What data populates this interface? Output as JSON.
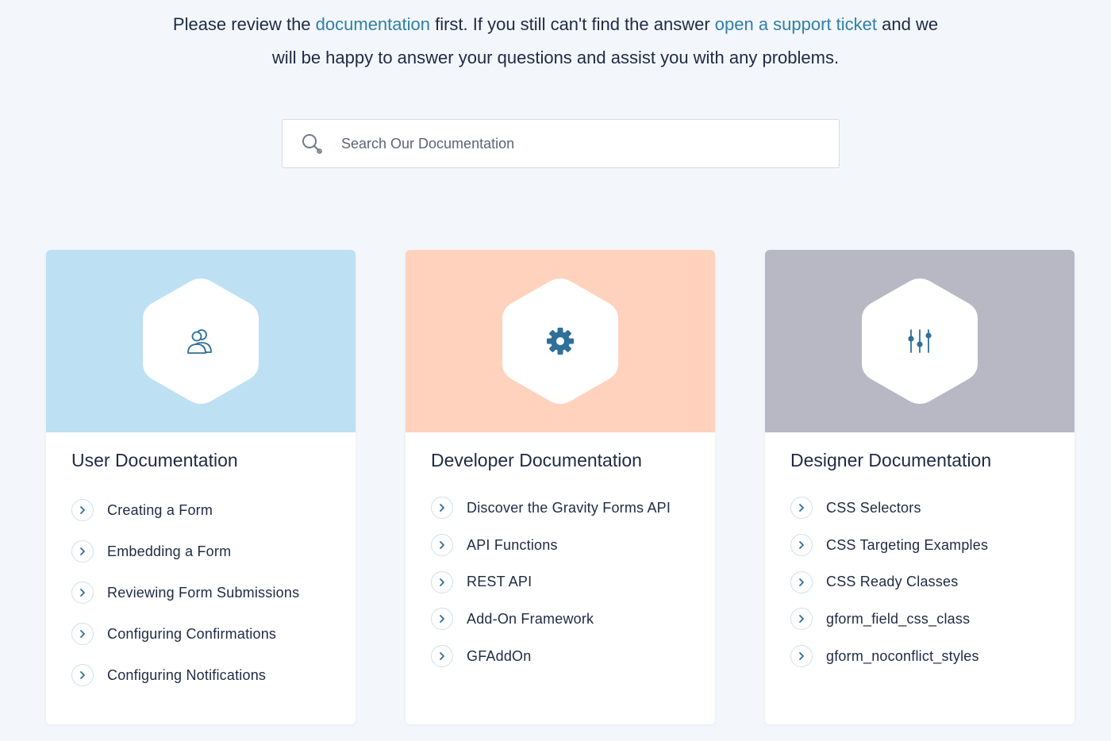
{
  "intro": {
    "text_1": "Please review the ",
    "link_docs": "documentation",
    "text_2": " first. If you still can't find the answer ",
    "link_ticket": "open a support ticket",
    "text_3": " and we",
    "line_2": "will be happy to answer your questions and assist you with any problems."
  },
  "search": {
    "placeholder": "Search Our Documentation",
    "icon": "search-icon"
  },
  "colors": {
    "link": "#2f7fa8",
    "user_banner": "#bde0f3",
    "developer_banner": "#ffd2bd",
    "designer_banner": "#b7b8c4",
    "icon": "#2f6f99"
  },
  "cards": [
    {
      "title": "User Documentation",
      "icon": "users-icon",
      "links": [
        "Creating a Form",
        "Embedding a Form",
        "Reviewing Form Submissions",
        "Configuring Confirmations",
        "Configuring Notifications"
      ]
    },
    {
      "title": "Developer Documentation",
      "icon": "gear-icon",
      "links": [
        "Discover the Gravity Forms API",
        "API Functions",
        "REST API",
        "Add-On Framework",
        "GFAddOn"
      ]
    },
    {
      "title": "Designer Documentation",
      "icon": "sliders-icon",
      "links": [
        "CSS Selectors",
        "CSS Targeting Examples",
        "CSS Ready Classes",
        "gform_field_css_class",
        "gform_noconflict_styles"
      ]
    }
  ]
}
